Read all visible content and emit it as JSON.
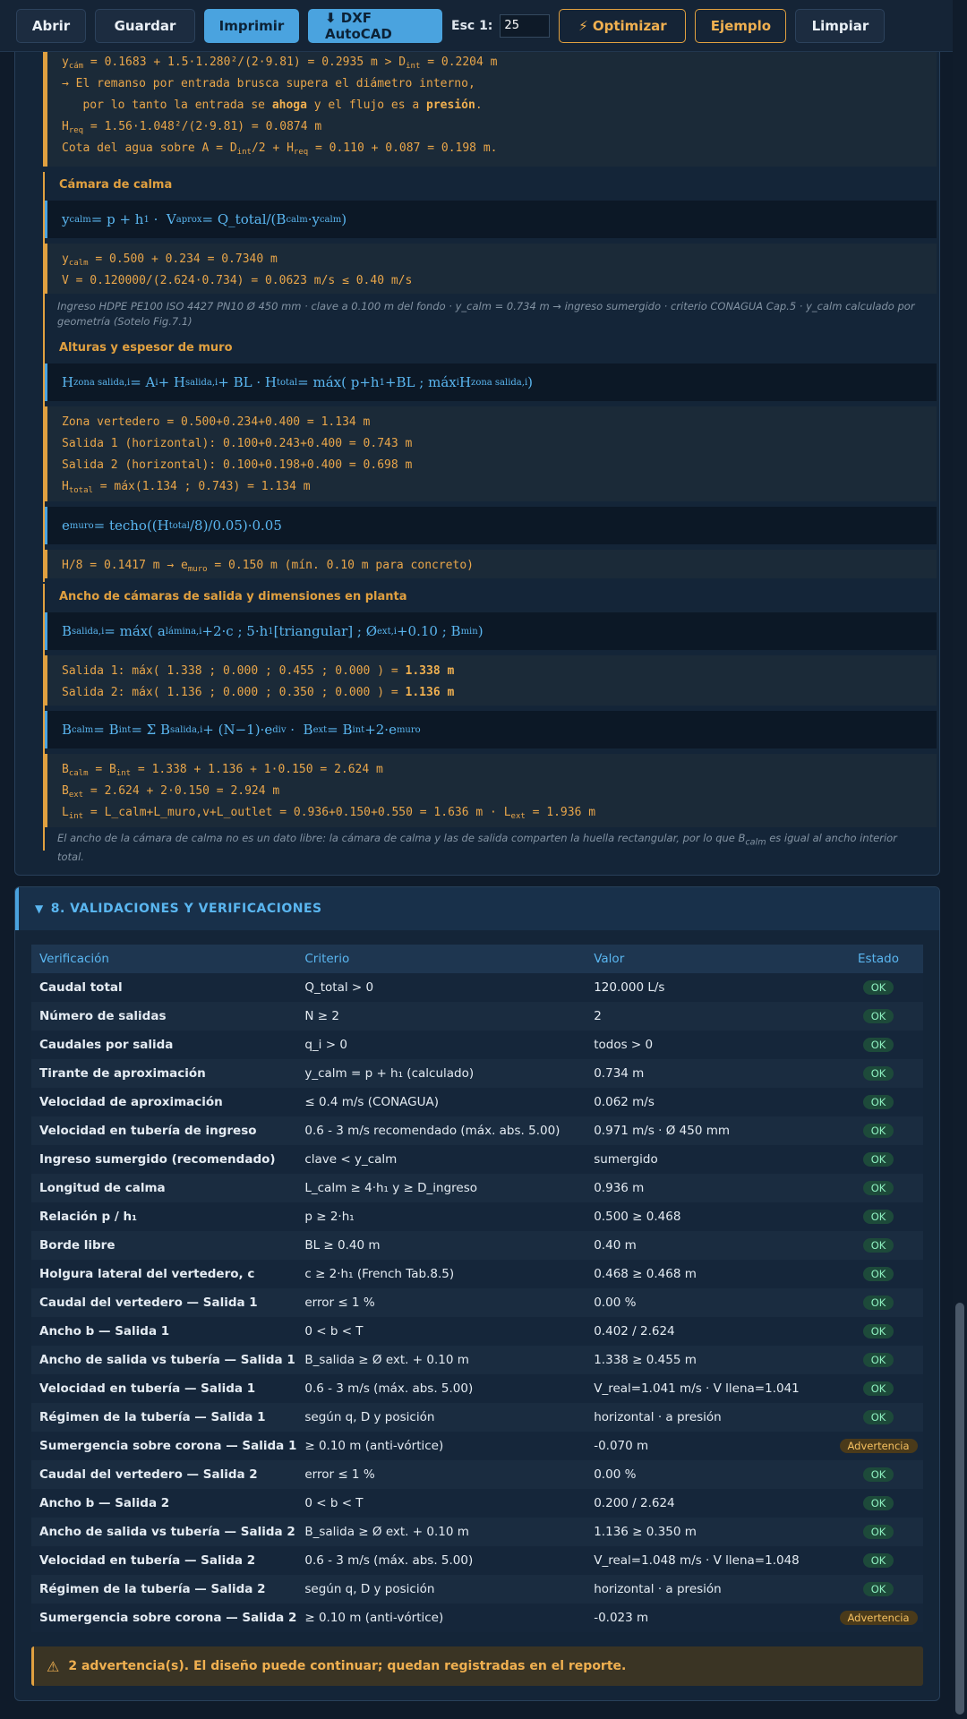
{
  "toolbar": {
    "abrir": "Abrir",
    "guardar": "Guardar",
    "imprimir": "Imprimir",
    "dxf": "⬇ DXF AutoCAD",
    "esc_label": "Esc 1:",
    "esc_value": "25",
    "optimizar": "⚡ Optimizar",
    "ejemplo": "Ejemplo",
    "limpiar": "Limpiar"
  },
  "top_calc": {
    "l1": "y<sub>cám</sub> = 0.1683 + 1.5·1.280²/(2·9.81) = 0.2935 m > D<sub>int</sub> = 0.2204 m",
    "l2": "→ El remanso por entrada brusca supera el diámetro interno,",
    "l3": "&nbsp;&nbsp;&nbsp;por lo tanto la entrada se <b>ahoga</b> y el flujo es a <b>presión</b>.",
    "l4": "H<sub>req</sub> = 1.56·1.048²/(2·9.81) = 0.0874 m",
    "l5": "Cota del agua sobre A = D<sub>int</sub>/2 + H<sub>req</sub> = 0.110 + 0.087 = 0.198 m."
  },
  "calma": {
    "title": "Cámara de calma",
    "formula": "y<sub>calm</sub> = p + h<sub>1</sub> &nbsp;·&nbsp; V<sub>aprox</sub> = Q_total/(B<sub>calm</sub>·y<sub>calm</sub>)",
    "l1": "y<sub>calm</sub> = 0.500 + 0.234 = 0.7340 m",
    "l2": "V = 0.120000/(2.624·0.734) = 0.0623 m/s ≤ 0.40 m/s",
    "note": "Ingreso HDPE PE100 ISO 4427 PN10 Ø 450 mm · clave a 0.100 m del fondo · y_calm = 0.734 m → ingreso sumergido · criterio CONAGUA Cap.5 · y_calm calculado por geometría (Sotelo Fig.7.1)"
  },
  "alturas": {
    "title": "Alturas y espesor de muro",
    "formula": "H<sub>zona salida,i</sub> = A<sub>i</sub> + H<sub>salida,i</sub> + BL · H<sub>total</sub> = máx( p+h<sub>1</sub>+BL ; máx<sub>i</sub> H<sub>zona salida,i</sub> )",
    "l1": "Zona vertedero = 0.500+0.234+0.400 = 1.134 m",
    "l2": "Salida 1 (horizontal): 0.100+0.243+0.400 = 0.743 m",
    "l3": "Salida 2 (horizontal): 0.100+0.198+0.400 = 0.698 m",
    "l4": "H<sub>total</sub> = máx(1.134 ; 0.743) = 1.134 m",
    "formula2": "e<sub>muro</sub> = techo((H<sub>total</sub>/8)/0.05)·0.05",
    "l5": "H/8 = 0.1417 m → e<sub>muro</sub> = 0.150 m (mín. 0.10 m para concreto)"
  },
  "ancho": {
    "title": "Ancho de cámaras de salida y dimensiones en planta",
    "formula": "B<sub>salida,i</sub> = máx( a<sub>lámina,i</sub>+2·c ; 5·h<sub>1</sub> [triangular] ; Ø<sub>ext,i</sub>+0.10 ; B<sub>min</sub> )",
    "l1": "Salida 1: máx( 1.338 ; 0.000 ; 0.455 ; 0.000 ) = <b>1.338 m</b>",
    "l2": "Salida 2: máx( 1.136 ; 0.000 ; 0.350 ; 0.000 ) = <b>1.136 m</b>",
    "formula2": "B<sub>calm</sub> = B<sub>int</sub> = Σ B<sub>salida,i</sub> + (N−1)·e<sub>div</sub> &nbsp;·&nbsp; B<sub>ext</sub> = B<sub>int</sub>+2·e<sub>muro</sub>",
    "l3": "B<sub>calm</sub> = B<sub>int</sub> = 1.338 + 1.136 + 1·0.150 = 2.624 m",
    "l4": "B<sub>ext</sub> = 2.624 + 2·0.150 = 2.924 m",
    "l5": "L<sub>int</sub> = L_calm+L_muro,v+L_outlet = 0.936+0.150+0.550 = 1.636 m · L<sub>ext</sub> = 1.936 m",
    "note": "El ancho de la cámara de calma no es un dato libre: la cámara de calma y las de salida comparten la huella rectangular, por lo que B<sub>calm</sub> es igual al ancho interior total."
  },
  "validaciones": {
    "title": "8. VALIDACIONES Y VERIFICACIONES",
    "headers": [
      "Verificación",
      "Criterio",
      "Valor",
      "Estado"
    ],
    "rows": [
      [
        "Caudal total",
        "Q_total > 0",
        "120.000 L/s",
        "OK"
      ],
      [
        "Número de salidas",
        "N ≥ 2",
        "2",
        "OK"
      ],
      [
        "Caudales por salida",
        "q_i > 0",
        "todos > 0",
        "OK"
      ],
      [
        "Tirante de aproximación",
        "y_calm = p + h₁ (calculado)",
        "0.734 m",
        "OK"
      ],
      [
        "Velocidad de aproximación",
        "≤ 0.4 m/s (CONAGUA)",
        "0.062 m/s",
        "OK"
      ],
      [
        "Velocidad en tubería de ingreso",
        "0.6 - 3 m/s recomendado (máx. abs. 5.00)",
        "0.971 m/s · Ø 450 mm",
        "OK"
      ],
      [
        "Ingreso sumergido (recomendado)",
        "clave < y_calm",
        "sumergido",
        "OK"
      ],
      [
        "Longitud de calma",
        "L_calm ≥ 4·h₁ y ≥ D_ingreso",
        "0.936 m",
        "OK"
      ],
      [
        "Relación p / h₁",
        "p ≥ 2·h₁",
        "0.500 ≥ 0.468",
        "OK"
      ],
      [
        "Borde libre",
        "BL ≥ 0.40 m",
        "0.40 m",
        "OK"
      ],
      [
        "Holgura lateral del vertedero, c",
        "c ≥ 2·h₁ (French Tab.8.5)",
        "0.468 ≥ 0.468 m",
        "OK"
      ],
      [
        "Caudal del vertedero — Salida 1",
        "error ≤ 1 %",
        "0.00 %",
        "OK"
      ],
      [
        "Ancho b — Salida 1",
        "0 < b < T",
        "0.402 / 2.624",
        "OK"
      ],
      [
        "Ancho de salida vs tubería — Salida 1",
        "B_salida ≥ Ø ext. + 0.10 m",
        "1.338 ≥ 0.455 m",
        "OK"
      ],
      [
        "Velocidad en tubería — Salida 1",
        "0.6 - 3 m/s (máx. abs. 5.00)",
        "V_real=1.041 m/s · V llena=1.041",
        "OK"
      ],
      [
        "Régimen de la tubería — Salida 1",
        "según q, D y posición",
        "horizontal · a presión",
        "OK"
      ],
      [
        "Sumergencia sobre corona — Salida 1",
        "≥ 0.10 m (anti-vórtice)",
        "-0.070 m",
        "Advertencia"
      ],
      [
        "Caudal del vertedero — Salida 2",
        "error ≤ 1 %",
        "0.00 %",
        "OK"
      ],
      [
        "Ancho b — Salida 2",
        "0 < b < T",
        "0.200 / 2.624",
        "OK"
      ],
      [
        "Ancho de salida vs tubería — Salida 2",
        "B_salida ≥ Ø ext. + 0.10 m",
        "1.136 ≥ 0.350 m",
        "OK"
      ],
      [
        "Velocidad en tubería — Salida 2",
        "0.6 - 3 m/s (máx. abs. 5.00)",
        "V_real=1.048 m/s · V llena=1.048",
        "OK"
      ],
      [
        "Régimen de la tubería — Salida 2",
        "según q, D y posición",
        "horizontal · a presión",
        "OK"
      ],
      [
        "Sumergencia sobre corona — Salida 2",
        "≥ 0.10 m (anti-vórtice)",
        "-0.023 m",
        "Advertencia"
      ]
    ],
    "warning": "2 advertencia(s). El diseño puede continuar; quedan registradas en el reporte."
  }
}
